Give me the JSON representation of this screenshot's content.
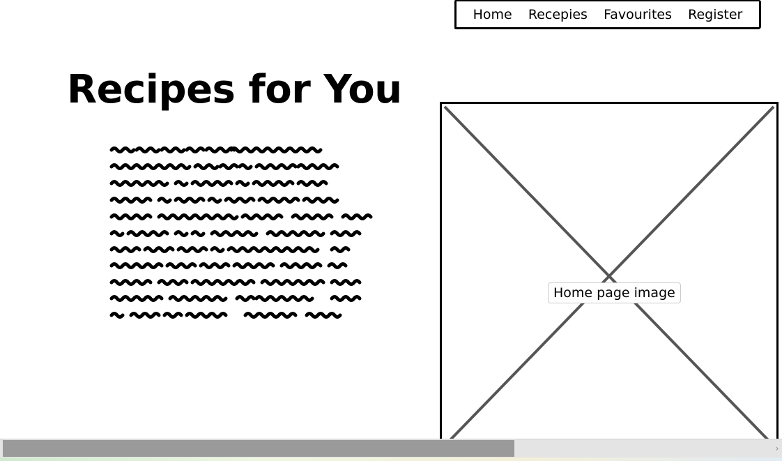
{
  "nav": {
    "items": [
      {
        "label": "Home"
      },
      {
        "label": "Recepies"
      },
      {
        "label": "Favourites"
      },
      {
        "label": "Register"
      }
    ]
  },
  "main": {
    "title": "Recipes for You",
    "body_text_icon": "scribbled-text-placeholder"
  },
  "image": {
    "label": "Home page image",
    "icon": "image-placeholder-x"
  },
  "scrollbar": {
    "position_fraction": 0.0,
    "visible_fraction": 0.66,
    "arrow_glyph": "›"
  }
}
